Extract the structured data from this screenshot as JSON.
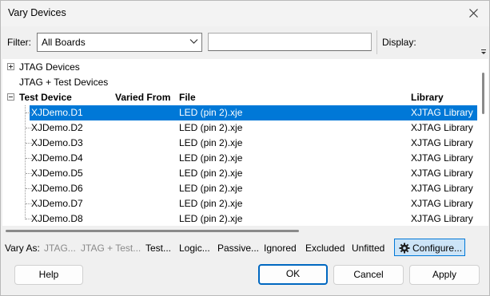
{
  "window": {
    "title": "Vary Devices"
  },
  "filter": {
    "label": "Filter:",
    "selected": "All Boards",
    "search_value": ""
  },
  "display": {
    "label": "Display:"
  },
  "tree": {
    "groups": [
      {
        "label": "JTAG Devices",
        "expander": "plus"
      },
      {
        "label": "JTAG + Test Devices"
      },
      {
        "label": "Test Device",
        "expander": "minus"
      }
    ],
    "columns": {
      "varied_from": "Varied From",
      "file": "File",
      "library": "Library"
    },
    "rows": [
      {
        "device": "XJDemo.D1",
        "file": "LED (pin 2).xje",
        "library": "XJTAG Library",
        "selected": true
      },
      {
        "device": "XJDemo.D2",
        "file": "LED (pin 2).xje",
        "library": "XJTAG Library"
      },
      {
        "device": "XJDemo.D3",
        "file": "LED (pin 2).xje",
        "library": "XJTAG Library"
      },
      {
        "device": "XJDemo.D4",
        "file": "LED (pin 2).xje",
        "library": "XJTAG Library"
      },
      {
        "device": "XJDemo.D5",
        "file": "LED (pin 2).xje",
        "library": "XJTAG Library"
      },
      {
        "device": "XJDemo.D6",
        "file": "LED (pin 2).xje",
        "library": "XJTAG Library"
      },
      {
        "device": "XJDemo.D7",
        "file": "LED (pin 2).xje",
        "library": "XJTAG Library"
      },
      {
        "device": "XJDemo.D8",
        "file": "LED (pin 2).xje",
        "library": "XJTAG Library"
      }
    ]
  },
  "vary_as": {
    "label": "Vary As:",
    "options": [
      "JTAG...",
      "JTAG + Test...",
      "Test...",
      "Logic...",
      "Passive...",
      "Ignored",
      "Excluded",
      "Unfitted"
    ],
    "configure_label": "Configure...",
    "configure_icon": "gear-icon"
  },
  "buttons": {
    "help": "Help",
    "ok": "OK",
    "cancel": "Cancel",
    "apply": "Apply"
  },
  "colors": {
    "selection": "#0078d7",
    "accent": "#0067c0"
  }
}
